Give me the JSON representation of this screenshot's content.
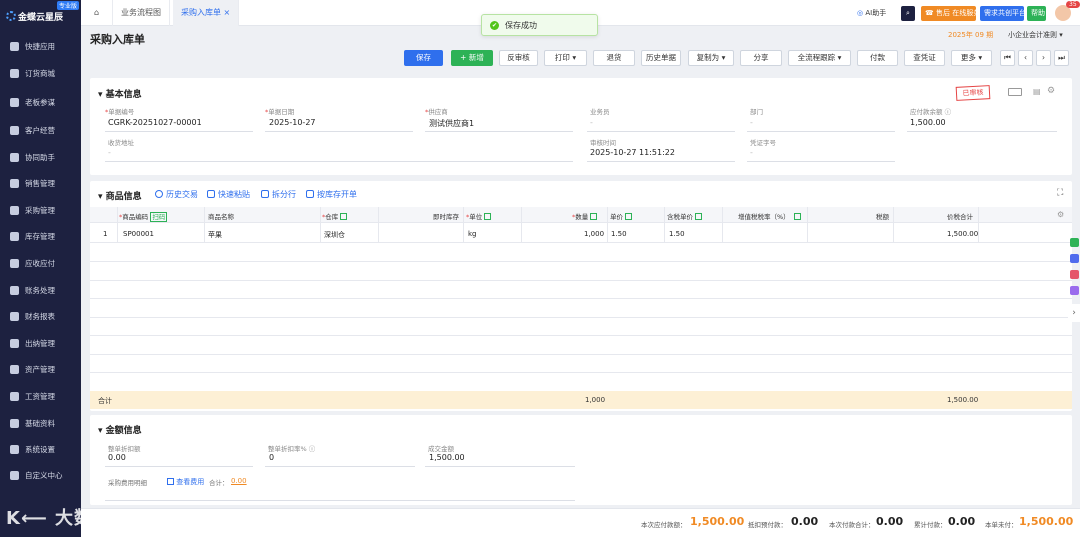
{
  "app": {
    "brand": "金蝶云星辰",
    "edition": "专业版",
    "watermark": "大数跨境"
  },
  "sidebar": {
    "items": [
      {
        "label": "快捷应用"
      },
      {
        "label": "订货商城"
      },
      {
        "label": "老板参谋"
      },
      {
        "label": "客户经营"
      },
      {
        "label": "协同助手"
      },
      {
        "label": "销售管理"
      },
      {
        "label": "采购管理"
      },
      {
        "label": "库存管理"
      },
      {
        "label": "应收应付"
      },
      {
        "label": "账务处理"
      },
      {
        "label": "财务报表"
      },
      {
        "label": "出纳管理"
      },
      {
        "label": "资产管理"
      },
      {
        "label": "工资管理"
      },
      {
        "label": "基础资料"
      },
      {
        "label": "系统设置"
      },
      {
        "label": "自定义中心"
      }
    ]
  },
  "tabs": [
    {
      "label": "业务流程图"
    },
    {
      "label": "采购入库单",
      "close": "×"
    }
  ],
  "toast": {
    "text": "保存成功"
  },
  "topbar": {
    "ai": "AI助手",
    "service": "售后 在线服务",
    "request": "需求共创平台",
    "help": "帮助",
    "badge": "35"
  },
  "header": {
    "title": "采购入库单",
    "period": "2025年 09 期",
    "company": "小企业会计准则"
  },
  "toolbar": {
    "save": "保存",
    "add": "新增",
    "unaudit": "反审核",
    "print": "打印",
    "return": "退货",
    "history": "历史单据",
    "copy": "复制为",
    "share": "分享",
    "trace": "全流程跟踪",
    "pay": "付款",
    "voucher": "查凭证",
    "more": "更多"
  },
  "basic": {
    "title": "基本信息",
    "stamp": "已审核",
    "fields": {
      "doc_no": {
        "label": "单据编号",
        "value": "CGRK-20251027-00001"
      },
      "doc_date": {
        "label": "单据日期",
        "value": "2025-10-27"
      },
      "supplier": {
        "label": "供应商",
        "value": "测试供应商1"
      },
      "salesman": {
        "label": "业务员",
        "value": "-"
      },
      "dept": {
        "label": "部门",
        "value": "-"
      },
      "balance": {
        "label": "应付款余额",
        "value": "1,500.00"
      },
      "address": {
        "label": "收货地址",
        "value": "-"
      },
      "audit_time": {
        "label": "审核时间",
        "value": "2025-10-27 11:51:22"
      },
      "voucher_no": {
        "label": "凭证字号",
        "value": "-"
      }
    }
  },
  "goods": {
    "title": "商品信息",
    "tools": [
      "历史交易",
      "快速粘贴",
      "拆分行",
      "按库存开单"
    ],
    "headers": [
      "商品编码",
      "商品名称",
      "仓库",
      "即时库存",
      "单位",
      "数量",
      "单价",
      "含税单价",
      "增值税税率（%）",
      "税额",
      "价税合计"
    ],
    "scan": "扫码",
    "rows": [
      {
        "no": "1",
        "code": "SP00001",
        "name": "苹果",
        "warehouse": "深圳仓",
        "stock": "",
        "unit": "kg",
        "qty": "1,000",
        "price": "1.50",
        "tax_price": "1.50",
        "tax_rate": "",
        "tax": "",
        "total": "1,500.00"
      }
    ],
    "sum": {
      "label": "合计",
      "qty": "1,000",
      "total": "1,500.00"
    }
  },
  "amount": {
    "title": "金额信息",
    "fields": {
      "discount": {
        "label": "整单折扣额",
        "value": "0.00"
      },
      "discount_rate": {
        "label": "整单折扣率%",
        "value": "0"
      },
      "deal": {
        "label": "成交金额",
        "value": "1,500.00"
      }
    },
    "fee": {
      "label": "采购费用明细",
      "link": "查看费用",
      "total_label": "合计：",
      "total": "0.00"
    }
  },
  "footer": {
    "payable": {
      "label": "本次应付款额：",
      "value": "1,500.00"
    },
    "prepay": {
      "label": "抵扣预付款：",
      "value": "0.00"
    },
    "paid": {
      "label": "本次付款合计：",
      "value": "0.00"
    },
    "total_paid": {
      "label": "累计付款：",
      "value": "0.00"
    },
    "unpaid": {
      "label": "本单未付：",
      "value": "1,500.00"
    }
  },
  "colors": {
    "accent": "#2f6fed",
    "green": "#2db256",
    "orange": "#f08a24",
    "sidebar": "#1d2140"
  }
}
